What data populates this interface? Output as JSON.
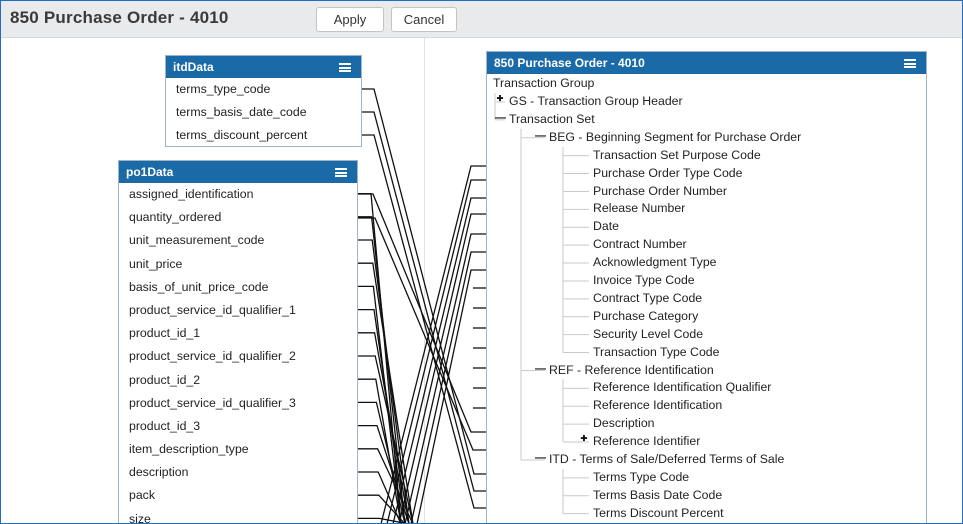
{
  "window": {
    "title": "850 Purchase Order - 4010",
    "apply_label": "Apply",
    "cancel_label": "Cancel"
  },
  "itd_panel": {
    "title": "itdData",
    "fields": [
      "terms_type_code",
      "terms_basis_date_code",
      "terms_discount_percent"
    ]
  },
  "po1_panel": {
    "title": "po1Data",
    "fields": [
      "assigned_identification",
      "quantity_ordered",
      "unit_measurement_code",
      "unit_price",
      "basis_of_unit_price_code",
      "product_service_id_qualifier_1",
      "product_id_1",
      "product_service_id_qualifier_2",
      "product_id_2",
      "product_service_id_qualifier_3",
      "product_id_3",
      "item_description_type",
      "description",
      "pack",
      "size"
    ]
  },
  "target_panel": {
    "title": "850 Purchase Order - 4010",
    "root": "Transaction Group",
    "nodes": [
      {
        "label": "GS - Transaction Group Header",
        "level": 1,
        "toggle": "+"
      },
      {
        "label": "Transaction Set",
        "level": 1,
        "toggle": "-"
      },
      {
        "label": "BEG - Beginning Segment for Purchase Order",
        "level": 2,
        "toggle": "-"
      },
      {
        "label": "Transaction Set Purpose Code",
        "level": 3,
        "toggle": ""
      },
      {
        "label": "Purchase Order Type Code",
        "level": 3,
        "toggle": ""
      },
      {
        "label": "Purchase Order Number",
        "level": 3,
        "toggle": ""
      },
      {
        "label": "Release Number",
        "level": 3,
        "toggle": ""
      },
      {
        "label": "Date",
        "level": 3,
        "toggle": ""
      },
      {
        "label": "Contract Number",
        "level": 3,
        "toggle": ""
      },
      {
        "label": "Acknowledgment Type",
        "level": 3,
        "toggle": ""
      },
      {
        "label": "Invoice Type Code",
        "level": 3,
        "toggle": ""
      },
      {
        "label": "Contract Type Code",
        "level": 3,
        "toggle": ""
      },
      {
        "label": "Purchase Category",
        "level": 3,
        "toggle": ""
      },
      {
        "label": "Security Level Code",
        "level": 3,
        "toggle": ""
      },
      {
        "label": "Transaction Type Code",
        "level": 3,
        "toggle": ""
      },
      {
        "label": "REF - Reference Identification",
        "level": 2,
        "toggle": "-"
      },
      {
        "label": "Reference Identification Qualifier",
        "level": 3,
        "toggle": ""
      },
      {
        "label": "Reference Identification",
        "level": 3,
        "toggle": ""
      },
      {
        "label": "Description",
        "level": 3,
        "toggle": ""
      },
      {
        "label": "Reference Identifier",
        "level": 3,
        "toggle": "+"
      },
      {
        "label": "ITD - Terms of Sale/Deferred Terms of Sale",
        "level": 2,
        "toggle": "-"
      },
      {
        "label": "Terms Type Code",
        "level": 3,
        "toggle": ""
      },
      {
        "label": "Terms Basis Date Code",
        "level": 3,
        "toggle": ""
      },
      {
        "label": "Terms Discount Percent",
        "level": 3,
        "toggle": ""
      }
    ]
  },
  "colors": {
    "panel_header": "#1b6aa8",
    "wire": "#111111"
  }
}
